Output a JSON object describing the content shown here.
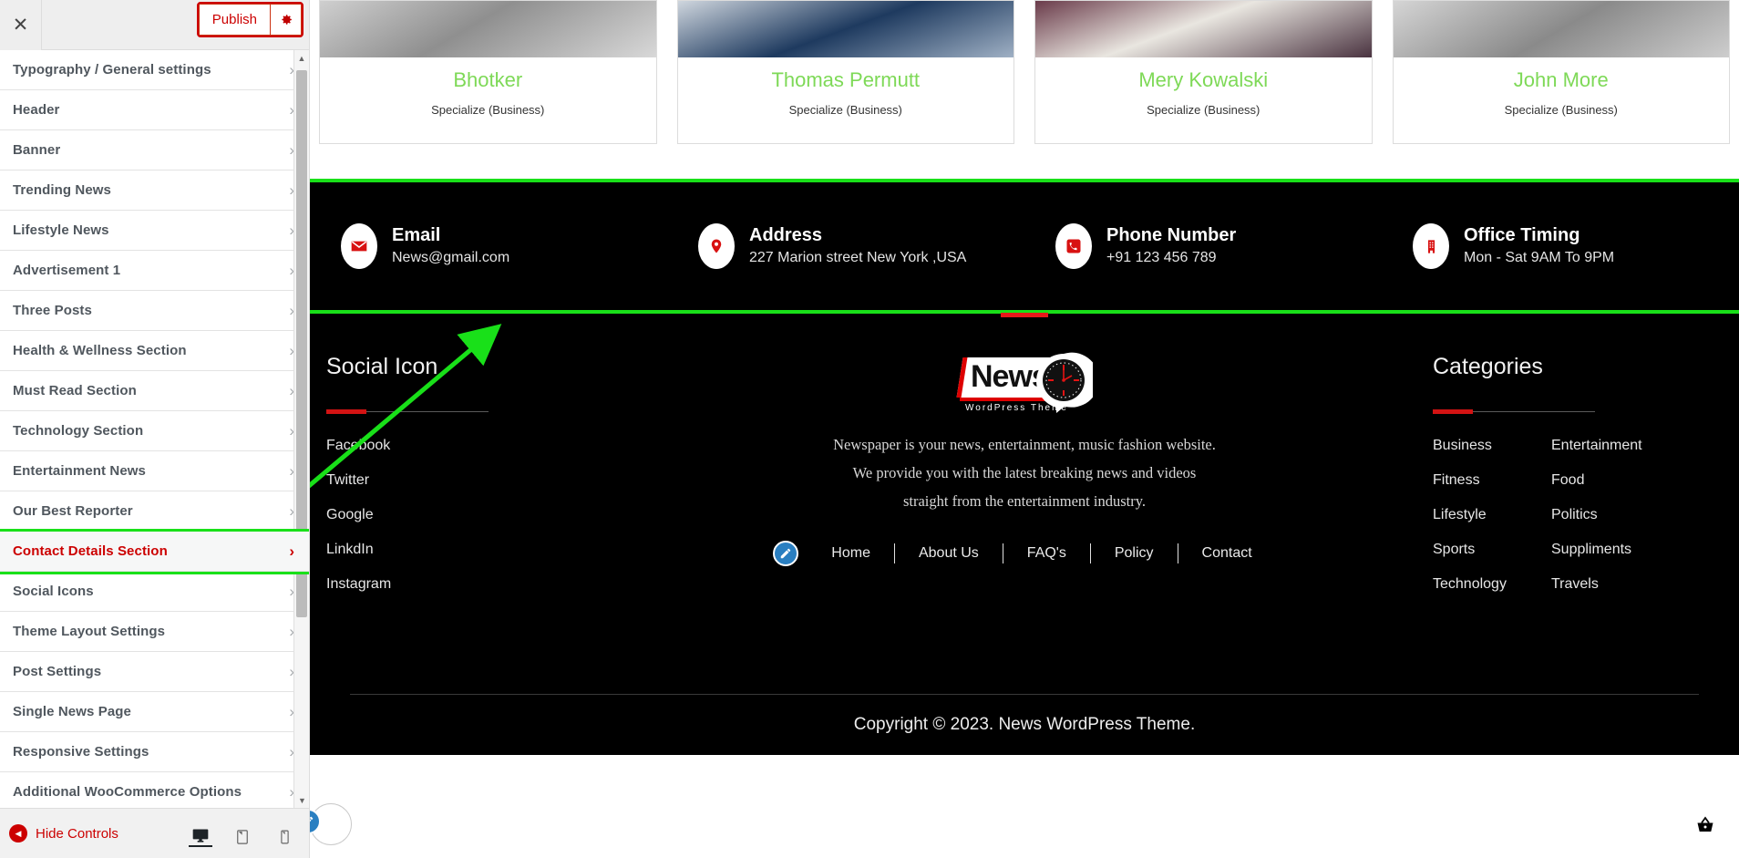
{
  "customizer": {
    "close_label": "✕",
    "publish_label": "Publish",
    "gear_icon": "gear-icon",
    "items": [
      {
        "label": "Typography / General settings",
        "active": false
      },
      {
        "label": "Header",
        "active": false
      },
      {
        "label": "Banner",
        "active": false
      },
      {
        "label": "Trending News",
        "active": false
      },
      {
        "label": "Lifestyle News",
        "active": false
      },
      {
        "label": "Advertisement 1",
        "active": false
      },
      {
        "label": "Three Posts",
        "active": false
      },
      {
        "label": "Health & Wellness Section",
        "active": false
      },
      {
        "label": "Must Read Section",
        "active": false
      },
      {
        "label": "Technology Section",
        "active": false
      },
      {
        "label": "Entertainment News",
        "active": false
      },
      {
        "label": "Our Best Reporter",
        "active": false
      },
      {
        "label": "Contact Details Section",
        "active": true
      },
      {
        "label": "Social Icons",
        "active": false
      },
      {
        "label": "Theme Layout Settings",
        "active": false
      },
      {
        "label": "Post Settings",
        "active": false
      },
      {
        "label": "Single News Page",
        "active": false
      },
      {
        "label": "Responsive Settings",
        "active": false
      },
      {
        "label": "Additional WooCommerce Options",
        "active": false
      }
    ],
    "chevron": "›",
    "hide_controls_label": "Hide Controls",
    "devices": [
      {
        "name": "desktop-view-icon",
        "active": true
      },
      {
        "name": "tablet-view-icon",
        "active": false
      },
      {
        "name": "mobile-view-icon",
        "active": false
      }
    ]
  },
  "reporters": [
    {
      "name": "Bhotker",
      "specialize": "Specialize (Business)"
    },
    {
      "name": "Thomas Permutt",
      "specialize": "Specialize (Business)"
    },
    {
      "name": "Mery Kowalski",
      "specialize": "Specialize (Business)"
    },
    {
      "name": "John More",
      "specialize": "Specialize (Business)"
    }
  ],
  "contact": [
    {
      "icon": "email-icon",
      "title": "Email",
      "value": "News@gmail.com"
    },
    {
      "icon": "map-pin-icon",
      "title": "Address",
      "value": "227 Marion street New York ,USA"
    },
    {
      "icon": "phone-icon",
      "title": "Phone Number",
      "value": "+91 123 456 789"
    },
    {
      "icon": "building-icon",
      "title": "Office Timing",
      "value": "Mon - Sat 9AM To 9PM"
    }
  ],
  "footer": {
    "logo": {
      "main": "News",
      "sub": "WordPress Theme"
    },
    "description_lines": [
      "Newspaper is your news, entertainment, music fashion website.",
      "We provide you with the latest breaking news and videos",
      "straight from the entertainment industry."
    ],
    "menu": [
      "Home",
      "About Us",
      "FAQ's",
      "Policy",
      "Contact"
    ],
    "social": {
      "title": "Social Icon",
      "links": [
        "Facebook",
        "Twitter",
        "Google",
        "LinkdIn",
        "Instagram"
      ]
    },
    "categories": {
      "title": "Categories",
      "links": [
        "Business",
        "Entertainment",
        "Fitness",
        "Food",
        "Lifestyle",
        "Politics",
        "Sports",
        "Suppliments",
        "Technology",
        "Travels"
      ]
    },
    "copyright": "Copyright © 2023.  News  WordPress Theme.",
    "cart_count": "0"
  },
  "colors": {
    "accent_red": "#d31313",
    "publish_red": "#c00000",
    "highlight_green": "#19e019",
    "reporter_green": "#7ed957",
    "footer_bg": "#000000",
    "edit_blue": "#2a7fc1"
  }
}
